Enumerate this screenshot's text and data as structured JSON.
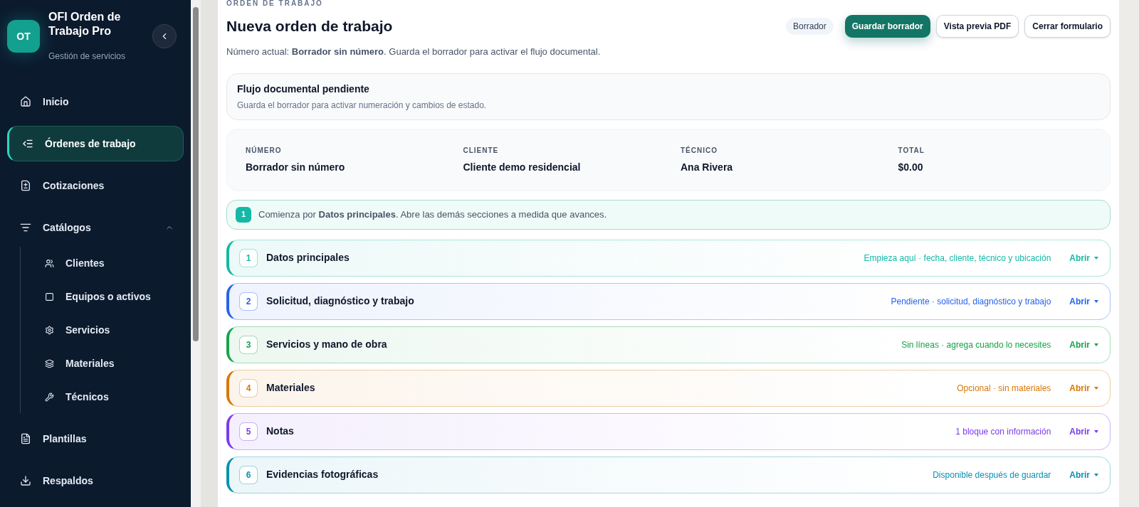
{
  "sidebar": {
    "logo": "OT",
    "app_name": "OFI Orden de Trabajo Pro",
    "subtitle": "Gestión de servicios",
    "items": [
      {
        "label": "Inicio",
        "selected": false
      },
      {
        "label": "Órdenes de trabajo",
        "selected": true
      },
      {
        "label": "Cotizaciones",
        "selected": false
      },
      {
        "label": "Catálogos",
        "selected": false,
        "expanded": true,
        "children": [
          {
            "label": "Clientes",
            "selected": false
          },
          {
            "label": "Equipos o activos",
            "selected": false
          },
          {
            "label": "Servicios",
            "selected": false
          },
          {
            "label": "Materiales",
            "selected": false
          },
          {
            "label": "Técnicos",
            "selected": false
          }
        ]
      },
      {
        "label": "Plantillas",
        "selected": false
      },
      {
        "label": "Respaldos",
        "selected": false
      }
    ]
  },
  "header": {
    "eyebrow": "ORDEN DE TRABAJO",
    "title": "Nueva orden de trabajo",
    "status_badge": "Borrador",
    "buttons": [
      {
        "label": "Guardar borrador",
        "kind": "primary"
      },
      {
        "label": "Vista previa PDF",
        "kind": "outline"
      },
      {
        "label": "Cerrar formulario",
        "kind": "outline"
      }
    ],
    "description": "Número actual: **Borrador sin número**. Guarda el borrador para activar el flujo documental."
  },
  "notice": {
    "title": "Flujo documental pendiente",
    "text": "Guarda el borrador para activar numeración y cambios de estado."
  },
  "summary": [
    {
      "label": "NÚMERO",
      "value": "Borrador sin número"
    },
    {
      "label": "CLIENTE",
      "value": "Cliente demo residencial"
    },
    {
      "label": "TÉCNICO",
      "value": "Ana Rivera"
    },
    {
      "label": "TOTAL",
      "value": "$0.00"
    }
  ],
  "hint": {
    "step": "1",
    "text": "Comienza por **Datos principales**. Abre las demás secciones a medida que avances."
  },
  "sections": [
    {
      "number": "1",
      "title": "Datos principales",
      "status": "Empieza aquí · fecha, cliente, técnico y ubicación",
      "action": "Abrir",
      "color": "#14b8a6"
    },
    {
      "number": "2",
      "title": "Solicitud, diagnóstico y trabajo",
      "status": "Pendiente · solicitud, diagnóstico y trabajo",
      "action": "Abrir",
      "color": "#2563eb"
    },
    {
      "number": "3",
      "title": "Servicios y mano de obra",
      "status": "Sin líneas · agrega cuando lo necesites",
      "action": "Abrir",
      "color": "#16a34a"
    },
    {
      "number": "4",
      "title": "Materiales",
      "status": "Opcional · sin materiales",
      "action": "Abrir",
      "color": "#d97706"
    },
    {
      "number": "5",
      "title": "Notas",
      "status": "1 bloque con información",
      "action": "Abrir",
      "color": "#7c3aed"
    },
    {
      "number": "6",
      "title": "Evidencias fotográficas",
      "status": "Disponible después de guardar",
      "action": "Abrir",
      "color": "#0891b2"
    }
  ]
}
